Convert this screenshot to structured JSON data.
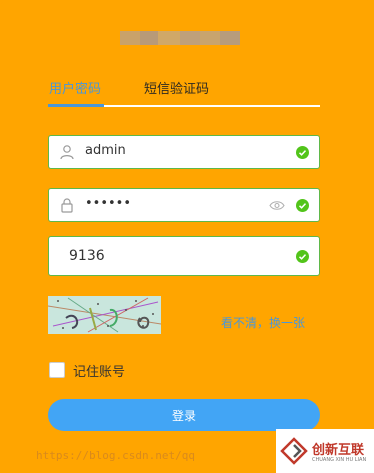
{
  "tabs": [
    {
      "label": "用户密码"
    },
    {
      "label": "短信验证码"
    }
  ],
  "username": {
    "value": "admin",
    "icon": "user-icon"
  },
  "password": {
    "value": "••••••",
    "icon": "lock-icon"
  },
  "verify_code": {
    "value": "9136"
  },
  "captcha": {
    "refresh_label": "看不清，换一张"
  },
  "remember": {
    "label": "记住账号"
  },
  "login_button": {
    "label": "登录"
  },
  "watermark": "https://blog.csdn.net/qq",
  "brand": {
    "name": "创新互联",
    "sub": "CHUANG XIN HU LIAN"
  },
  "colors": {
    "background": "#ffa500",
    "accent": "#4a97d8",
    "button": "#42a5f5",
    "valid": "#52c41a"
  }
}
